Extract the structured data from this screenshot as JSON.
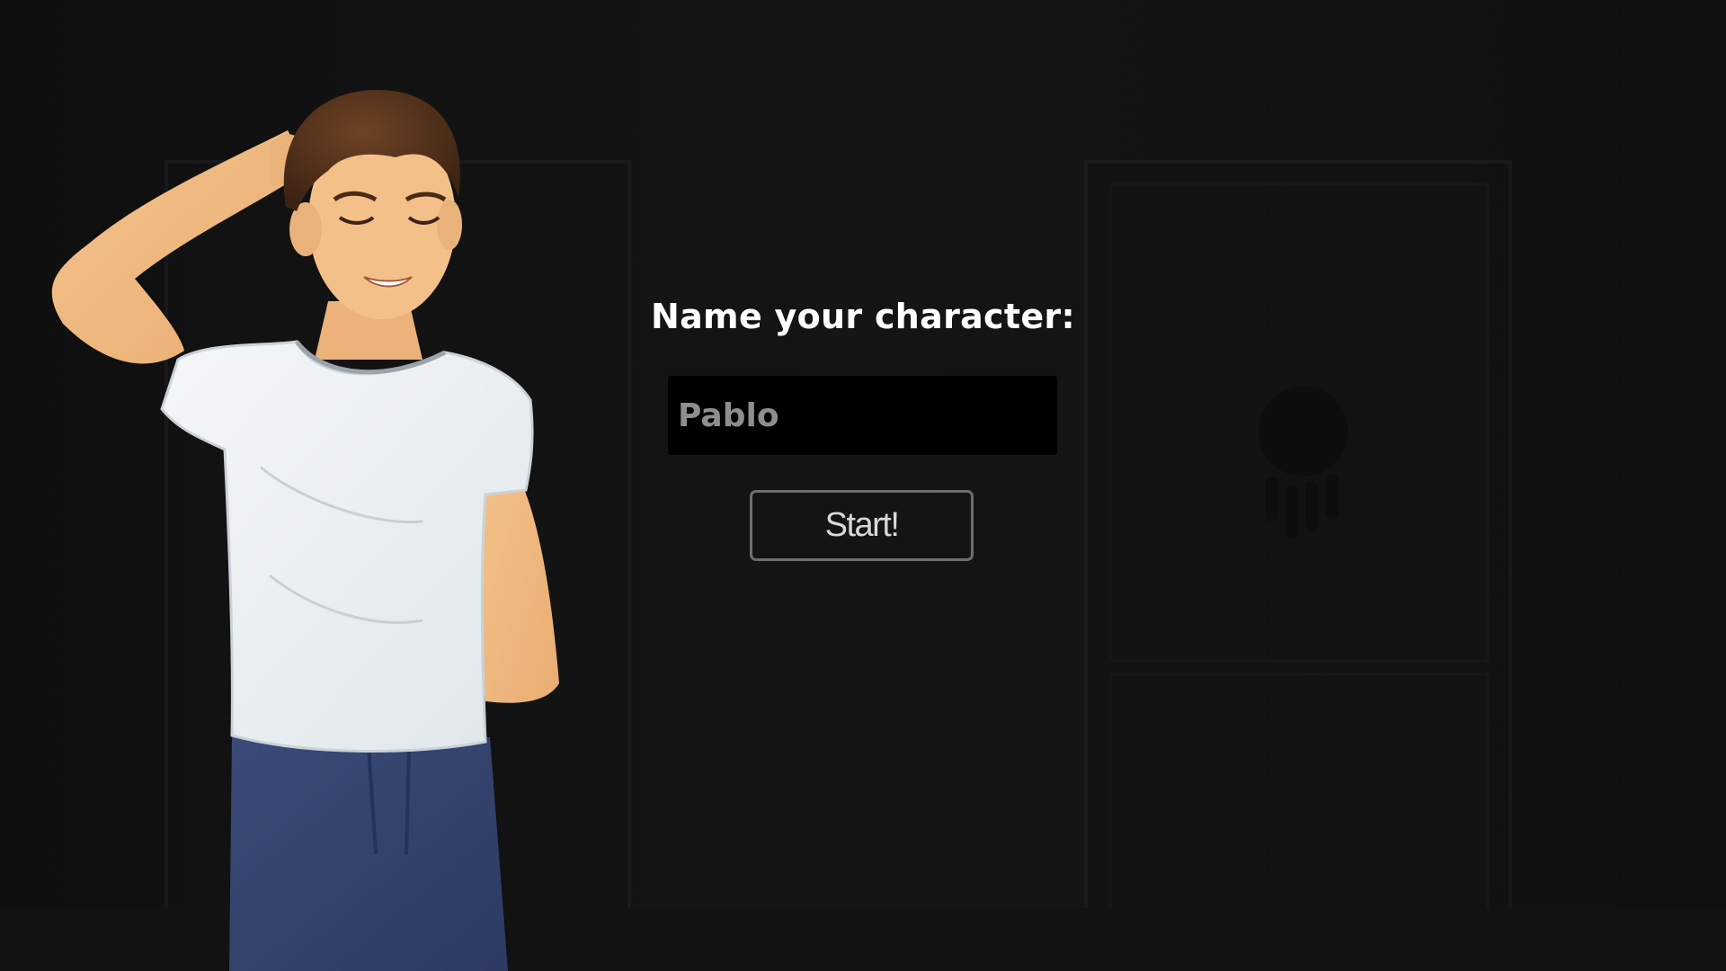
{
  "screen": {
    "prompt_label": "Name your character:",
    "name_input": {
      "value": "Pablo",
      "placeholder": "Pablo"
    },
    "start_label": "Start!"
  },
  "background": {
    "scene": "dark-room-with-doors",
    "decoration": "dreamcatcher-silhouette"
  },
  "character": {
    "pose": "hand-behind-head-smiling",
    "outfit": "white-tshirt-blue-jeans"
  },
  "colors": {
    "background": "#141414",
    "input_bg": "#000000",
    "input_text": "#8e8e8e",
    "button_border": "#6d6d6d",
    "button_text": "#d8d8d8",
    "prompt_text": "#ffffff"
  }
}
